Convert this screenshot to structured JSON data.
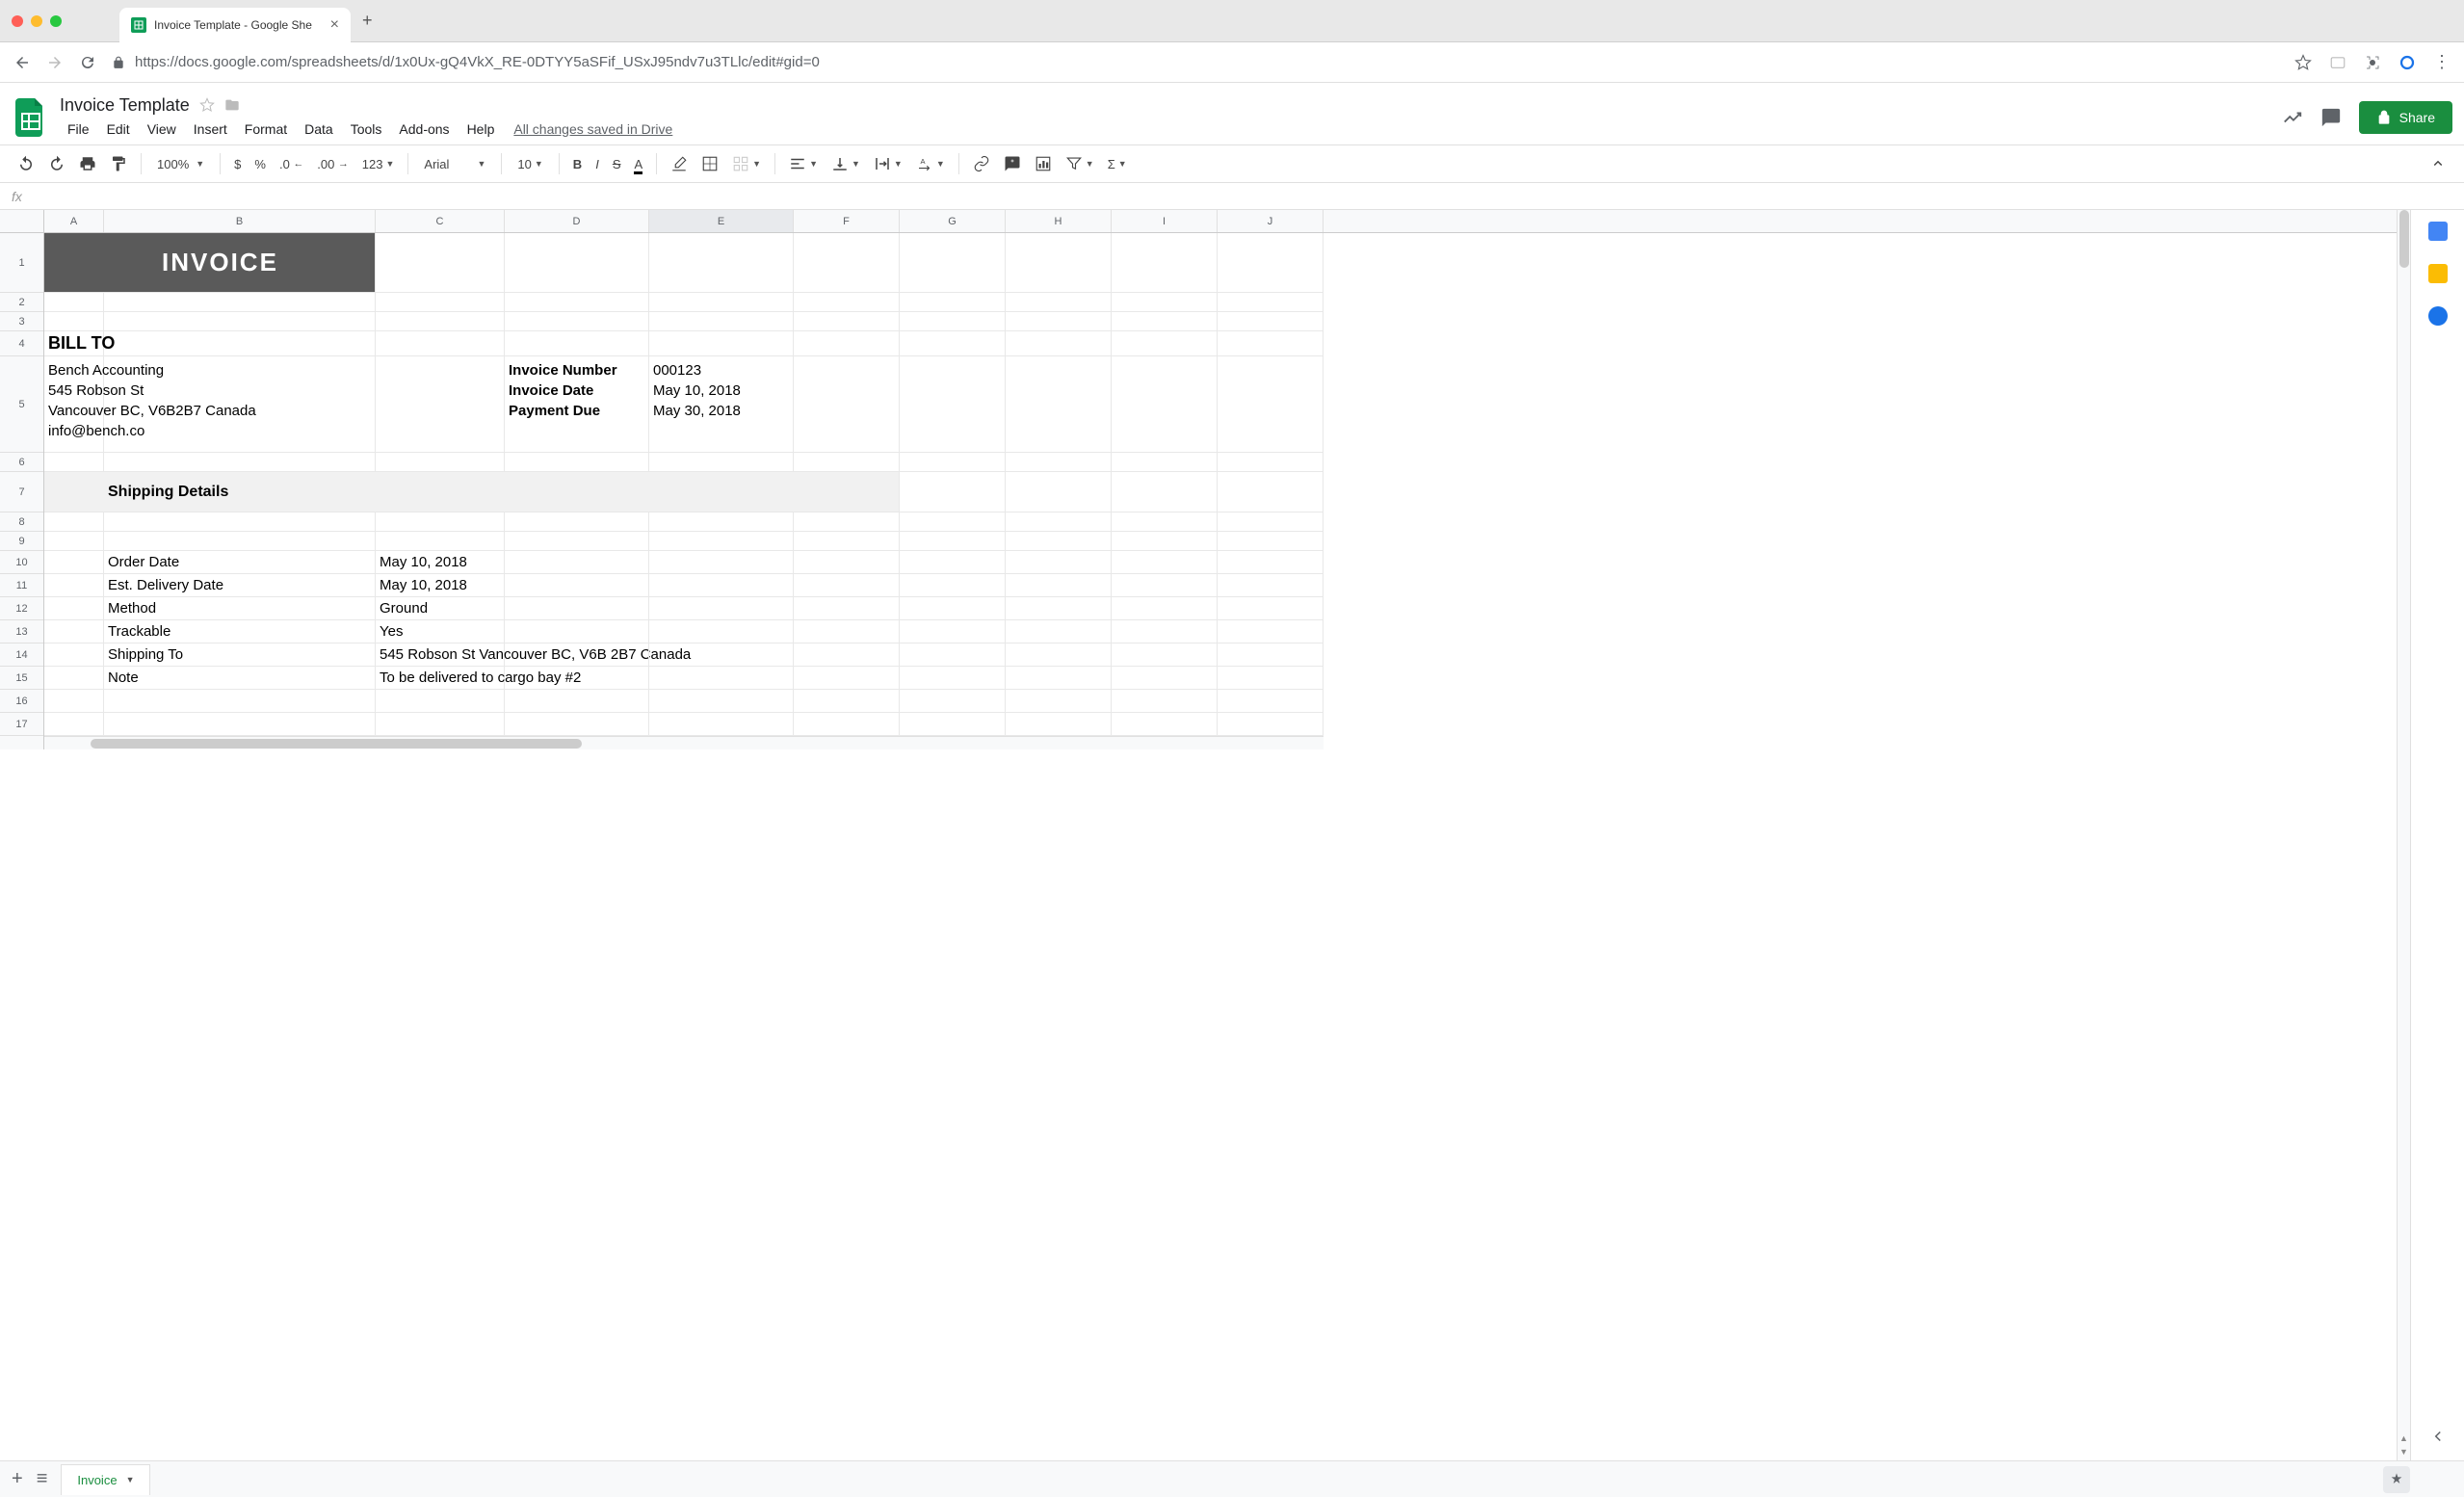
{
  "browser": {
    "tab_title": "Invoice Template - Google She",
    "url": "https://docs.google.com/spreadsheets/d/1x0Ux-gQ4VkX_RE-0DTYY5aSFif_USxJ95ndv7u3TLlc/edit#gid=0"
  },
  "doc": {
    "title": "Invoice Template",
    "save_status": "All changes saved in Drive"
  },
  "menus": [
    "File",
    "Edit",
    "View",
    "Insert",
    "Format",
    "Data",
    "Tools",
    "Add-ons",
    "Help"
  ],
  "share_label": "Share",
  "toolbar": {
    "zoom": "100%",
    "font": "Arial",
    "size": "10"
  },
  "columns": [
    "A",
    "B",
    "C",
    "D",
    "E",
    "F",
    "G",
    "H",
    "I",
    "J"
  ],
  "rows": [
    "1",
    "2",
    "3",
    "4",
    "5",
    "6",
    "7",
    "8",
    "9",
    "10",
    "11",
    "12",
    "13",
    "14",
    "15",
    "16",
    "17"
  ],
  "invoice": {
    "title": "INVOICE",
    "bill_to_label": "BILL TO",
    "bill_to_name": "Bench Accounting",
    "bill_to_street": "545 Robson St",
    "bill_to_city": "Vancouver BC, V6B2B7 Canada",
    "bill_to_email": "info@bench.co",
    "inv_num_label": "Invoice Number",
    "inv_num": "000123",
    "inv_date_label": "Invoice Date",
    "inv_date": "May 10, 2018",
    "pay_due_label": "Payment Due",
    "pay_due": "May 30, 2018",
    "shipping_header": "Shipping Details",
    "order_date_label": "Order Date",
    "order_date": "May 10, 2018",
    "delivery_label": "Est. Delivery Date",
    "delivery": "May 10, 2018",
    "method_label": "Method",
    "method": "Ground",
    "trackable_label": "Trackable",
    "trackable": "Yes",
    "ship_to_label": "Shipping To",
    "ship_to": "545 Robson St Vancouver BC, V6B 2B7 Canada",
    "note_label": "Note",
    "note": "To be delivered to cargo bay #2"
  },
  "sheet_tab": "Invoice"
}
